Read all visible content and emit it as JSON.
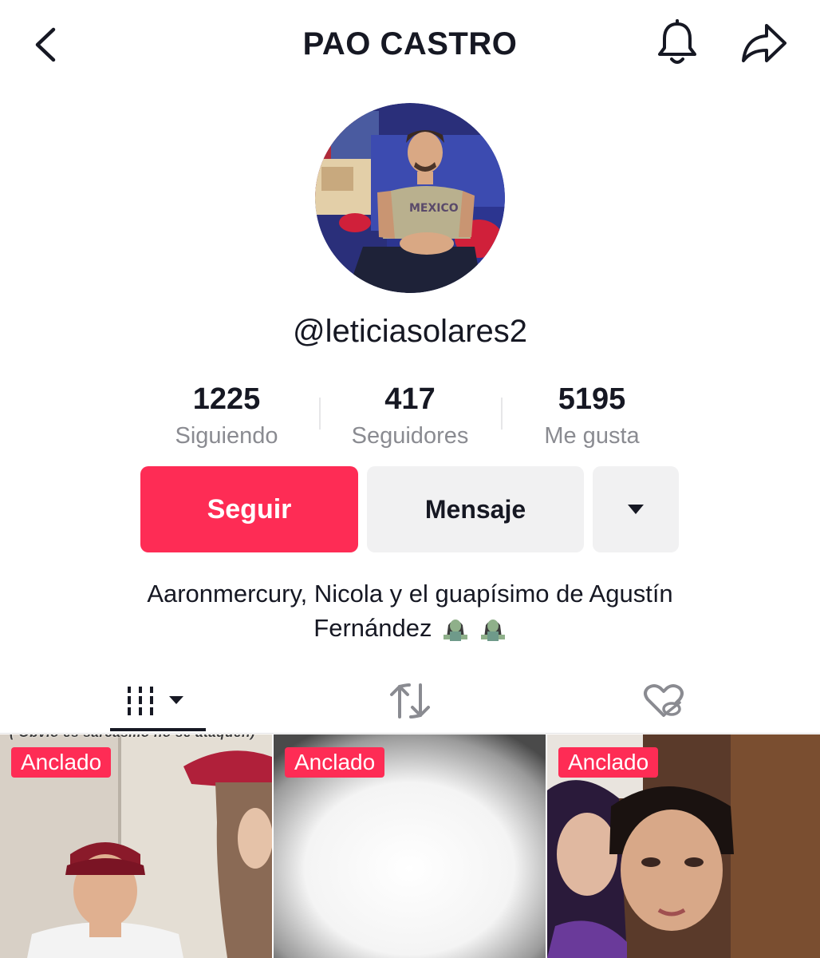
{
  "header": {
    "title": "PAO CASTRO",
    "back_icon": "chevron-left-icon",
    "bell_icon": "bell-icon",
    "share_icon": "share-arrow-icon"
  },
  "profile": {
    "username": "@leticiasolares2",
    "avatar": "profile-photo"
  },
  "stats": [
    {
      "value": "1225",
      "label": "Siguiendo"
    },
    {
      "value": "417",
      "label": "Seguidores"
    },
    {
      "value": "5195",
      "label": "Me gusta"
    }
  ],
  "actions": {
    "follow_label": "Seguir",
    "message_label": "Mensaje",
    "more_icon": "caret-down-icon"
  },
  "bio": {
    "line1": "Aaronmercury, Nicola y el guapísimo de Agustín",
    "line2": "Fernández",
    "emojis": [
      "zombie-woman-emoji",
      "zombie-woman-emoji"
    ]
  },
  "tabs": [
    {
      "name": "videos",
      "icon": "grid-bars-icon",
      "active": true
    },
    {
      "name": "reposts",
      "icon": "repost-icon",
      "active": false
    },
    {
      "name": "liked",
      "icon": "hidden-heart-icon",
      "active": false
    }
  ],
  "videos": [
    {
      "badge": "Anclado",
      "caption": "( Obvio es sarcasmo no se ataquen)"
    },
    {
      "badge": "Anclado"
    },
    {
      "badge": "Anclado"
    }
  ],
  "colors": {
    "accent": "#fe2c55",
    "text_primary": "#161823",
    "text_secondary": "#8a8b91",
    "button_gray": "#f1f1f2"
  }
}
